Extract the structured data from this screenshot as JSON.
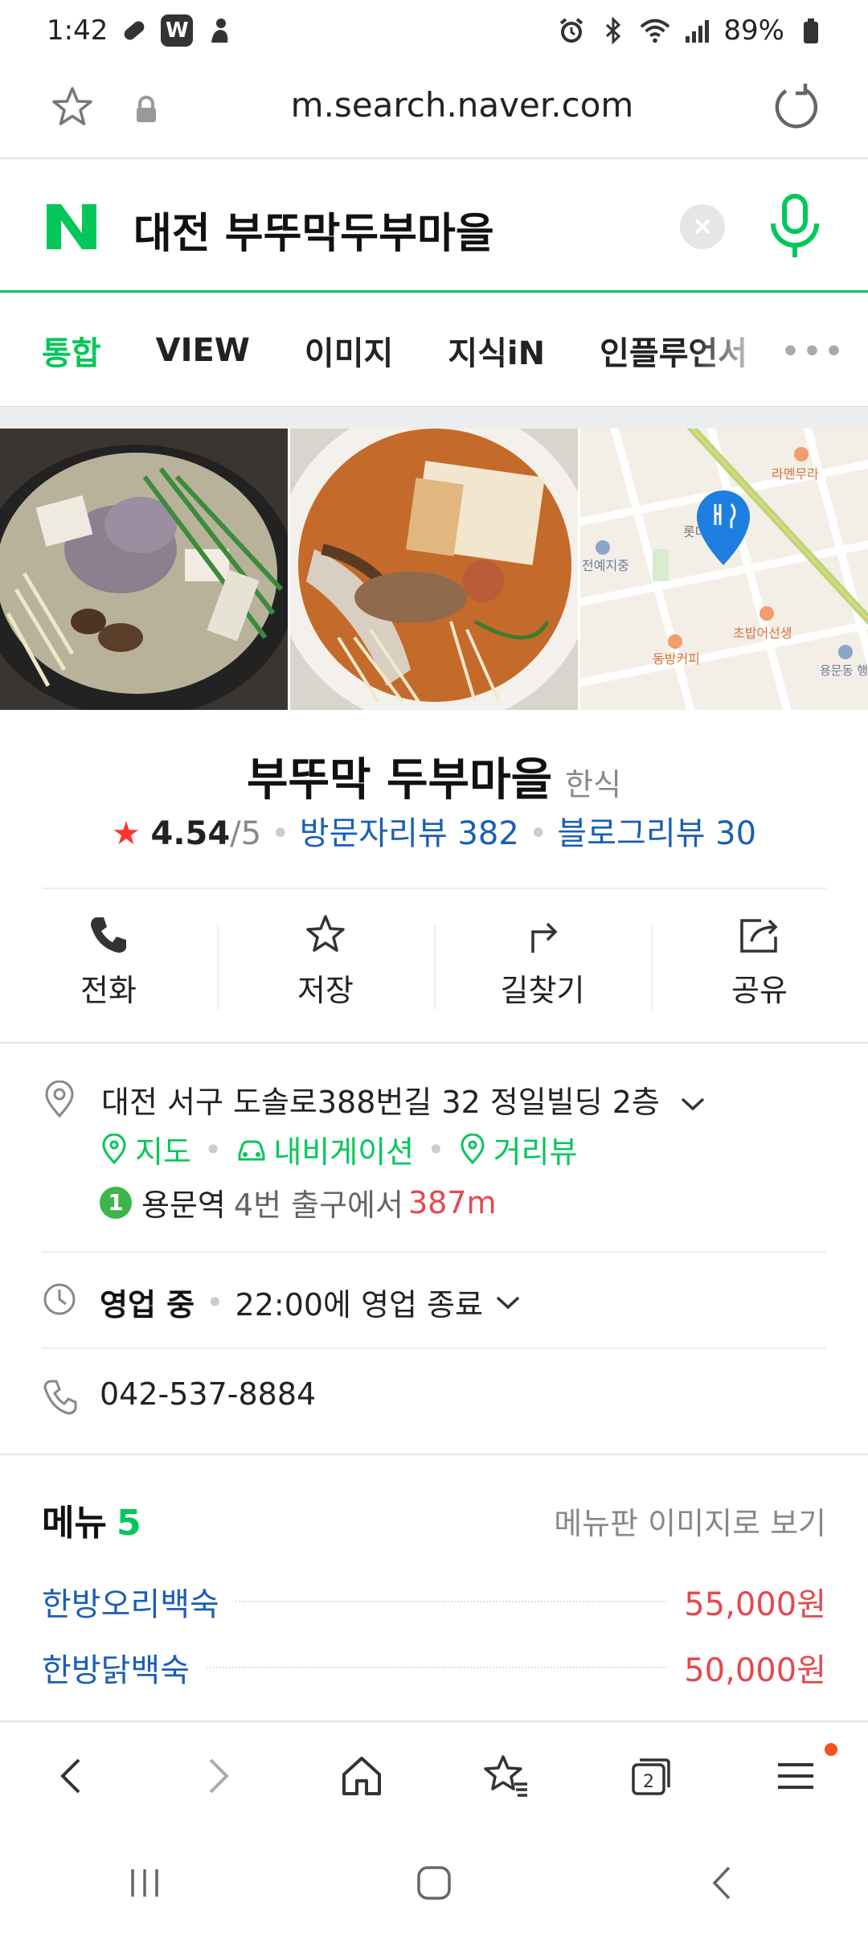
{
  "status_bar": {
    "time": "1:42",
    "app_badge": "W",
    "battery": "89%"
  },
  "address_bar": {
    "url": "m.search.naver.com"
  },
  "search": {
    "query": "대전 부뚜막두부마을"
  },
  "tabs": [
    {
      "label": "통합",
      "active": true
    },
    {
      "label": "VIEW",
      "active": false
    },
    {
      "label": "이미지",
      "active": false
    },
    {
      "label": "지식iN",
      "active": false
    },
    {
      "label": "인플루언서",
      "active": false
    }
  ],
  "tabs_more": "•••",
  "map_labels": {
    "ramen": "라멘무라",
    "lotte": "롯데",
    "hall": "전예지중",
    "chobap": "초밥어선생",
    "dongbang": "동방커피",
    "office": "용문동\n행정복지센"
  },
  "place": {
    "name": "부뚜막 두부마을",
    "category": "한식",
    "rating_star": "★",
    "rating": "4.54",
    "rating_max": "/5",
    "visitor_reviews": "방문자리뷰 382",
    "blog_reviews": "블로그리뷰 30"
  },
  "actions": [
    {
      "label": "전화",
      "icon": "phone-icon"
    },
    {
      "label": "저장",
      "icon": "star-icon"
    },
    {
      "label": "길찾기",
      "icon": "directions-icon"
    },
    {
      "label": "공유",
      "icon": "share-icon"
    }
  ],
  "address": {
    "text": "대전 서구 도솔로388번길 32 정일빌딩 2층",
    "links": [
      "지도",
      "내비게이션",
      "거리뷰"
    ],
    "station_line": "1",
    "station_name": "용문역",
    "station_exit": "4번 출구에서",
    "station_distance": "387m"
  },
  "hours": {
    "status": "영업 중",
    "detail": "22:00에 영업 종료"
  },
  "phone": "042-537-8884",
  "menu": {
    "title": "메뉴",
    "count": "5",
    "view_image": "메뉴판 이미지로 보기",
    "items": [
      {
        "name": "한방오리백숙",
        "price": "55,000원"
      },
      {
        "name": "한방닭백숙",
        "price": "50,000원"
      }
    ]
  },
  "colors": {
    "naver_green": "#03c75a",
    "link_blue": "#1a5fb4",
    "price_red": "#e5484d"
  }
}
